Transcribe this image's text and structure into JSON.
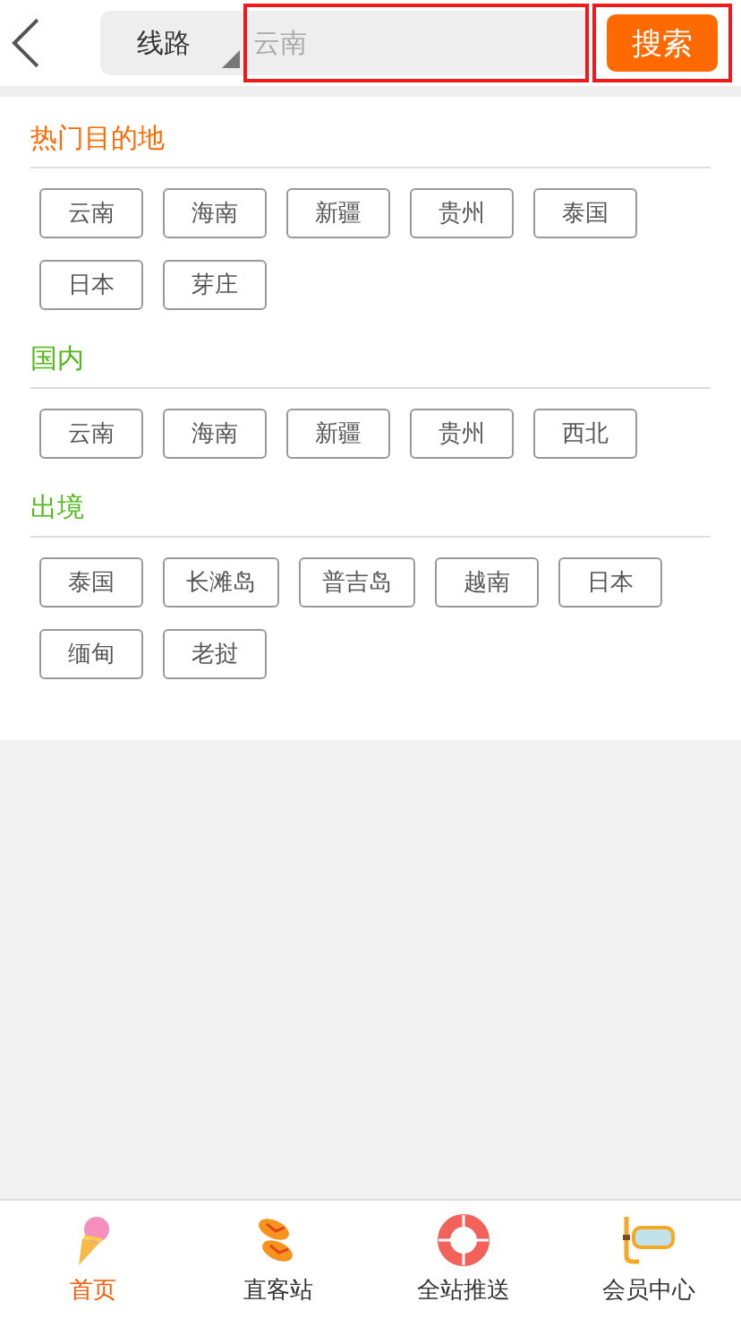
{
  "header": {
    "category": "线路",
    "search": {
      "placeholder": "云南"
    },
    "search_button": "搜索"
  },
  "sections": [
    {
      "title": "热门目的地",
      "color": "#ff6a00",
      "tags": [
        "云南",
        "海南",
        "新疆",
        "贵州",
        "泰国",
        "日本",
        "芽庄"
      ]
    },
    {
      "title": "国内",
      "color": "#52b818",
      "tags": [
        "云南",
        "海南",
        "新疆",
        "贵州",
        "西北"
      ]
    },
    {
      "title": "出境",
      "color": "#52b818",
      "tags": [
        "泰国",
        "长滩岛",
        "普吉岛",
        "越南",
        "日本",
        "缅甸",
        "老挝"
      ]
    }
  ],
  "tab_bar": [
    {
      "label": "首页",
      "kind": "icecream",
      "selected": true
    },
    {
      "label": "直客站",
      "kind": "flipflops",
      "selected": false
    },
    {
      "label": "全站推送",
      "kind": "lifebuoy",
      "selected": false
    },
    {
      "label": "会员中心",
      "kind": "snorkel",
      "selected": false
    }
  ]
}
